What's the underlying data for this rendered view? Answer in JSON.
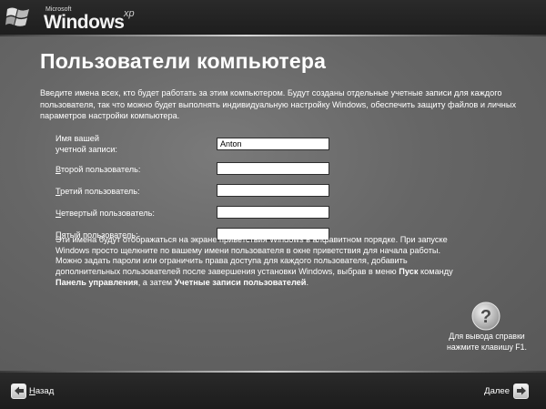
{
  "header": {
    "logo_microsoft": "Microsoft",
    "logo_windows": "Windows",
    "logo_xp": "xp"
  },
  "page": {
    "title": "Пользователи компьютера",
    "intro_lines": [
      "Введите имена всех, кто будет работать за этим компьютером. Будут созданы отдельные учетные записи для каждого",
      "пользователя, так что можно будет выполнять индивидуальную настройку Windows, обеспечить защиту файлов и личных",
      "параметров настройки компьютера."
    ]
  },
  "form": {
    "field1": {
      "label_line1": "Имя вашей",
      "label_line2": "учетной записи:",
      "value": "Anton"
    },
    "field2": {
      "label_accel": "В",
      "label_rest": "торой пользователь:",
      "value": ""
    },
    "field3": {
      "label_accel": "Т",
      "label_rest": "ретий пользователь:",
      "value": ""
    },
    "field4": {
      "label_accel": "Ч",
      "label_rest": "етвертый пользователь:",
      "value": ""
    },
    "field5": {
      "label_accel": "П",
      "label_rest": "ятый пользователь:",
      "value": ""
    }
  },
  "info": {
    "line1": "Эти имена будут отображаться на экране приветствия Windows в алфавитном порядке. При запуске",
    "line2": "Windows просто щелкните по вашему имени пользователя в окне приветствия для начала работы.",
    "line3": "Можно задать пароли или ограничить права доступа для каждого пользователя, добавить",
    "line4_pre": "дополнительных пользователей после завершения установки Windows, выбрав в меню ",
    "line4_bold": "Пуск",
    "line4_post": " команду",
    "line5_bold1": "Панель управления",
    "line5_mid": ", а затем ",
    "line5_bold2": "Учетные записи пользователей",
    "line5_end": "."
  },
  "help": {
    "icon": "question-icon",
    "line1": "Для вывода справки",
    "line2": "нажмите клавишу F1."
  },
  "nav": {
    "back_accel": "Н",
    "back_rest": "азад",
    "next_label": "Далее"
  }
}
